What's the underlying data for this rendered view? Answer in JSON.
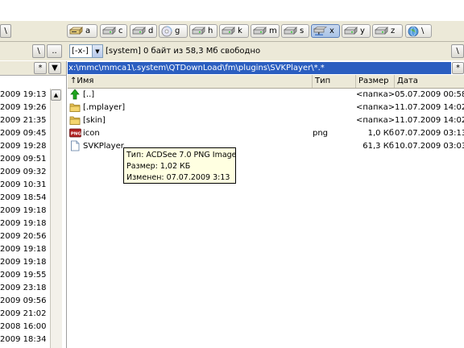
{
  "toolbar": {
    "left_button": "\\",
    "drives": [
      {
        "letter": "a",
        "icon": "floppy-drive-icon"
      },
      {
        "letter": "c",
        "icon": "hard-drive-icon"
      },
      {
        "letter": "d",
        "icon": "hard-drive-icon"
      },
      {
        "letter": "g",
        "icon": "cd-drive-icon"
      },
      {
        "letter": "h",
        "icon": "hard-drive-icon"
      },
      {
        "letter": "k",
        "icon": "hard-drive-icon"
      },
      {
        "letter": "m",
        "icon": "hard-drive-icon"
      },
      {
        "letter": "s",
        "icon": "hard-drive-icon"
      },
      {
        "letter": "x",
        "icon": "network-drive-icon",
        "active": true
      },
      {
        "letter": "y",
        "icon": "hard-drive-icon"
      },
      {
        "letter": "z",
        "icon": "hard-drive-icon"
      },
      {
        "letter": "\\",
        "icon": "network-globe-icon"
      }
    ]
  },
  "pathrow": {
    "root_button": "\\",
    "up_button": "..",
    "drive_combo": "[-x-]",
    "volume_label": "[system]",
    "free_space": "0 байт из 58,3 Мб свободно",
    "right_root_button": "\\"
  },
  "left_panel": {
    "sort_button": "*",
    "dates": [
      "2009 19:13",
      "2009 19:26",
      "2009 21:35",
      "2009 09:45",
      "2009 19:28",
      "2009 09:51",
      "2009 09:32",
      "2009 10:31",
      "2009 18:54",
      "2009 19:18",
      "2009 19:18",
      "2009 20:56",
      "2009 19:18",
      "2009 19:18",
      "2009 19:55",
      "2009 23:18",
      "2009 09:56",
      "2009 21:02",
      "2008 16:00",
      "2009 18:34"
    ]
  },
  "right_panel": {
    "path": "x:\\mmc\\mmca1\\.system\\QTDownLoad\\fm\\plugins\\SVKPlayer\\*.*",
    "sort_button": "*",
    "columns": {
      "name": "↑Имя",
      "type": "Тип",
      "size": "Размер",
      "date": "Дата"
    },
    "files": [
      {
        "name": "[..]",
        "type": "",
        "size": "<папка>",
        "date": "05.07.2009 00:58",
        "icon": "up-arrow-icon"
      },
      {
        "name": "[.mplayer]",
        "type": "",
        "size": "<папка>",
        "date": "11.07.2009 14:02",
        "icon": "folder-icon"
      },
      {
        "name": "[skin]",
        "type": "",
        "size": "<папка>",
        "date": "11.07.2009 14:02",
        "icon": "folder-icon"
      },
      {
        "name": "icon",
        "type": "png",
        "size": "1,0 Кб",
        "date": "07.07.2009 03:13",
        "icon": "png-file-icon"
      },
      {
        "name": "SVKPlayer",
        "type": "",
        "size": "61,3 Кб",
        "date": "10.07.2009 03:03",
        "icon": "file-icon"
      }
    ]
  },
  "tooltip": {
    "type_line": "Тип: ACDSee 7.0 PNG Image",
    "size_line": "Размер: 1,02 КБ",
    "modified_line": "Изменен: 07.07.2009 3:13"
  },
  "colors": {
    "path_bar": "#2b5ec0",
    "toolbar_bg": "#ece9d8",
    "tooltip_bg": "#ffffe1"
  }
}
